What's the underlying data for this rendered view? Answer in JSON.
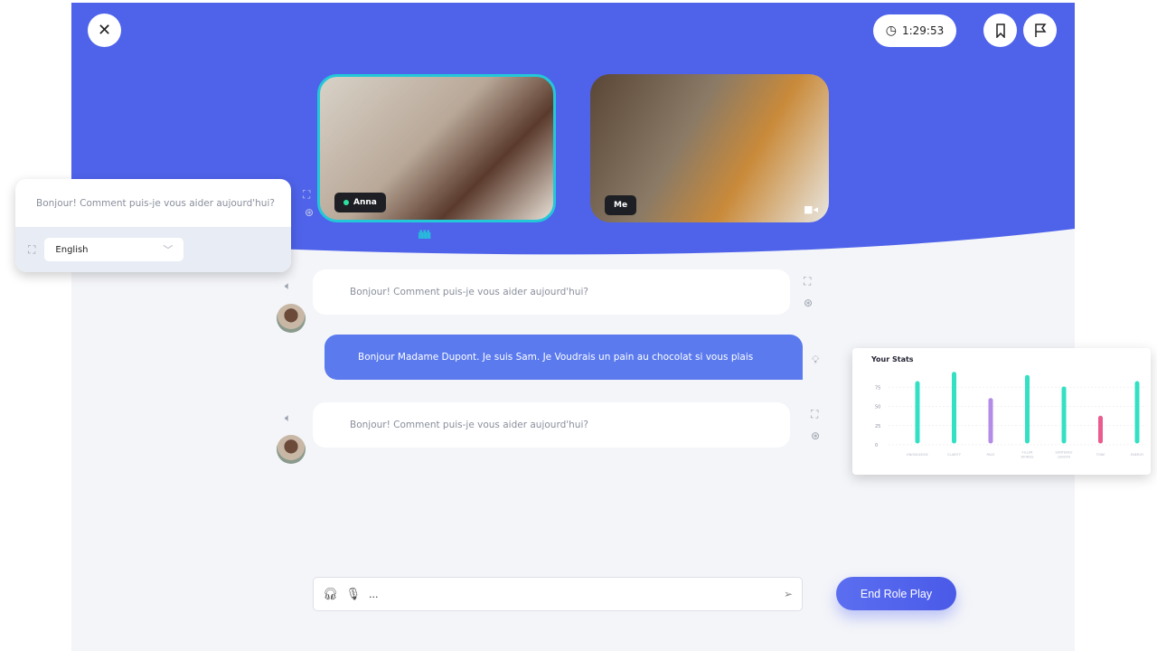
{
  "header": {
    "timer": "1:29:53",
    "accent": "#4f63ea"
  },
  "videos": [
    {
      "name": "Anna",
      "speaking": true
    },
    {
      "name": "Me"
    }
  ],
  "translation_popup": {
    "text": "Bonjour! Comment puis-je vous aider aujourd'hui?",
    "language": "English"
  },
  "messages": [
    {
      "sender": "Anna",
      "text": "Bonjour! Comment puis-je vous aider aujourd'hui?"
    },
    {
      "sender": "Me",
      "text": "Bonjour Madame Dupont. Je suis Sam. Je Voudrais un pain au chocolat si vous plais"
    },
    {
      "sender": "Anna",
      "text": "Bonjour! Comment puis-je vous aider aujourd'hui?"
    }
  ],
  "composer": {
    "value": "..."
  },
  "end_button": "End Role Play",
  "chart_data": {
    "type": "bar",
    "title": "Your Stats",
    "categories": [
      "KNOWLEDGE",
      "CLARITY",
      "PACE",
      "FILLER WORDS",
      "SENTENCE LENGTH",
      "TONE",
      "ENERGY"
    ],
    "values": [
      80,
      92,
      58,
      88,
      73,
      35,
      80
    ],
    "colors": [
      "#34e0c4",
      "#34e0c4",
      "#b48be6",
      "#34e0c4",
      "#34e0c4",
      "#ea5c8e",
      "#34e0c4"
    ],
    "yticks": [
      "0",
      "25",
      "50",
      "75"
    ],
    "ylim": [
      0,
      100
    ],
    "grid": true
  }
}
